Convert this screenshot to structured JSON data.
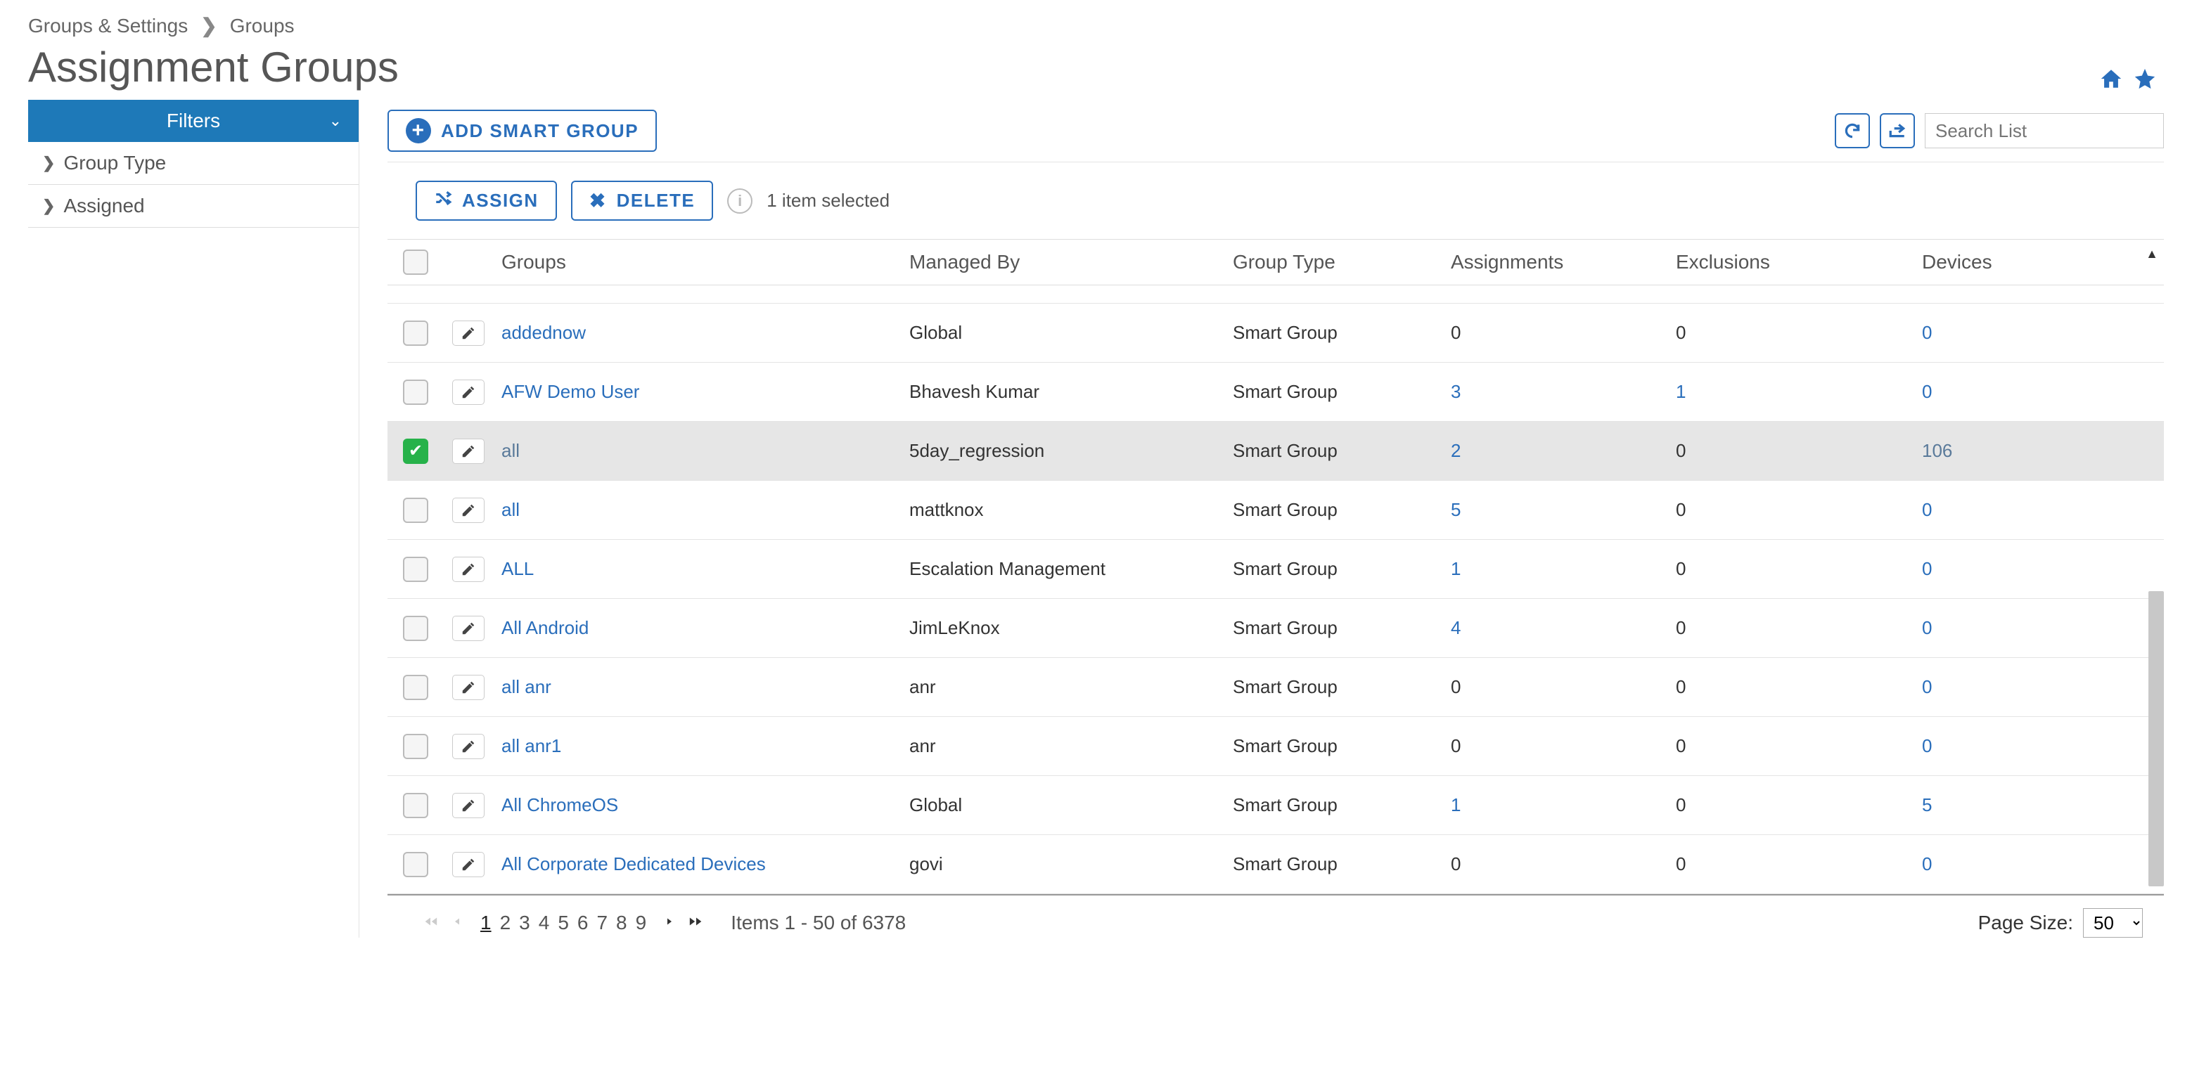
{
  "breadcrumb": {
    "root": "Groups & Settings",
    "current": "Groups"
  },
  "page_title": "Assignment Groups",
  "top_icons": {
    "home": "home-icon",
    "star": "star-icon"
  },
  "sidebar": {
    "filters_label": "Filters",
    "items": [
      {
        "label": "Group Type"
      },
      {
        "label": "Assigned"
      }
    ]
  },
  "toolbar": {
    "add_smart_group": "ADD SMART GROUP",
    "search_placeholder": "Search List"
  },
  "actionbar": {
    "assign": "ASSIGN",
    "delete": "DELETE",
    "selected": "1 item selected"
  },
  "columns": {
    "groups": "Groups",
    "managed_by": "Managed By",
    "group_type": "Group Type",
    "assignments": "Assignments",
    "exclusions": "Exclusions",
    "devices": "Devices"
  },
  "rows": [
    {
      "checked": false,
      "name": "addednow",
      "managed": "Global",
      "type": "Smart Group",
      "assign": "0",
      "excl": "0",
      "dev": "0",
      "sel": false
    },
    {
      "checked": false,
      "name": "AFW Demo User",
      "managed": "Bhavesh Kumar",
      "type": "Smart Group",
      "assign": "3",
      "excl": "1",
      "dev": "0",
      "sel": false
    },
    {
      "checked": true,
      "name": "all",
      "managed": "5day_regression",
      "type": "Smart Group",
      "assign": "2",
      "excl": "0",
      "dev": "106",
      "sel": true
    },
    {
      "checked": false,
      "name": "all",
      "managed": "mattknox",
      "type": "Smart Group",
      "assign": "5",
      "excl": "0",
      "dev": "0",
      "sel": false
    },
    {
      "checked": false,
      "name": "ALL",
      "managed": "Escalation Management",
      "type": "Smart Group",
      "assign": "1",
      "excl": "0",
      "dev": "0",
      "sel": false
    },
    {
      "checked": false,
      "name": "All Android",
      "managed": "JimLeKnox",
      "type": "Smart Group",
      "assign": "4",
      "excl": "0",
      "dev": "0",
      "sel": false
    },
    {
      "checked": false,
      "name": "all anr",
      "managed": "anr",
      "type": "Smart Group",
      "assign": "0",
      "excl": "0",
      "dev": "0",
      "sel": false
    },
    {
      "checked": false,
      "name": "all anr1",
      "managed": "anr",
      "type": "Smart Group",
      "assign": "0",
      "excl": "0",
      "dev": "0",
      "sel": false
    },
    {
      "checked": false,
      "name": "All ChromeOS",
      "managed": "Global",
      "type": "Smart Group",
      "assign": "1",
      "excl": "0",
      "dev": "5",
      "sel": false
    },
    {
      "checked": false,
      "name": "All Corporate Dedicated Devices",
      "managed": "govi",
      "type": "Smart Group",
      "assign": "0",
      "excl": "0",
      "dev": "0",
      "sel": false
    }
  ],
  "pager": {
    "pages": [
      "1",
      "2",
      "3",
      "4",
      "5",
      "6",
      "7",
      "8",
      "9"
    ],
    "current": "1",
    "items_info": "Items 1 - 50 of 6378",
    "page_size_label": "Page Size:",
    "page_size_value": "50"
  }
}
